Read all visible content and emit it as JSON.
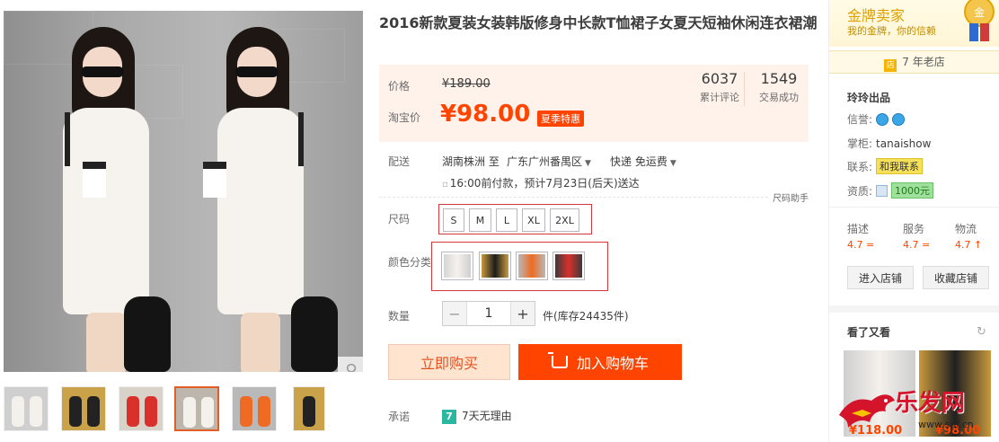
{
  "product": {
    "title": "2016新款夏装女装韩版修身中长款T恤裙子女夏天短袖休闲连衣裙潮"
  },
  "price": {
    "label": "价格",
    "original": "¥189.00",
    "promo_label": "淘宝价",
    "current": "¥98.00",
    "badge": "夏季特惠"
  },
  "stats": {
    "reviews_count": "6037",
    "reviews_label": "累计评论",
    "sales_count": "1549",
    "sales_label": "交易成功"
  },
  "delivery": {
    "label": "配送",
    "from": "湖南株洲 至",
    "to": "广东广州番禺区",
    "shipping": "快递 免运费",
    "eta": "16:00前付款，预计7月23日(后天)送达",
    "size_helper": "尺码助手"
  },
  "size": {
    "label": "尺码",
    "options": [
      "S",
      "M",
      "L",
      "XL",
      "2XL"
    ]
  },
  "color": {
    "label": "颜色分类",
    "options": [
      "white-dress",
      "black-dress",
      "orange-dress",
      "red-dress"
    ]
  },
  "quantity": {
    "label": "数量",
    "value": "1",
    "minus": "−",
    "plus": "+",
    "stock": "件(库存24435件)"
  },
  "actions": {
    "buy_now": "立即购买",
    "add_to_cart": "加入购物车"
  },
  "promise": {
    "label": "承诺",
    "icon_text": "7",
    "text": "7天无理由"
  },
  "seller": {
    "tier": "金牌卖家",
    "tier_sub": "我的金牌，你的信赖",
    "medal_text": "金",
    "years": "7 年老店",
    "years_icon": "店",
    "shop_name": "玲玲出品",
    "credit_label": "信誉:",
    "owner_label": "掌柜:",
    "owner": "tanaishow",
    "contact_label": "联系:",
    "contact_button": "和我联系",
    "qualification_label": "资质:",
    "deposit": "1000元",
    "ratings": [
      {
        "label": "描述",
        "value": "4.7 ="
      },
      {
        "label": "服务",
        "value": "4.7 ="
      },
      {
        "label": "物流",
        "value": "4.7 ↑"
      }
    ],
    "enter_store": "进入店铺",
    "favorite_store": "收藏店铺",
    "also_viewed_title": "看了又看",
    "also_viewed_prices": [
      "¥118.00",
      "¥98.00"
    ]
  },
  "watermark": {
    "text": "乐发网",
    "url": "www.spf.cn"
  },
  "colors": {
    "accent": "#ff4400",
    "price": "#ff4400",
    "price_panel_bg": "#fff2ea",
    "highlight_border": "#d23a3a",
    "gold": "#e0a000"
  }
}
